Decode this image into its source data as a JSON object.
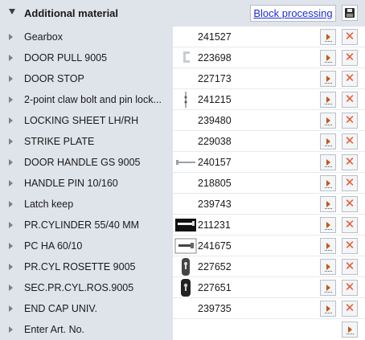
{
  "header": {
    "title": "Additional material",
    "block_processing_label": "Block processing"
  },
  "colors": {
    "panel_bg": "#dfe3ea",
    "link_blue": "#1a2fd6",
    "delete_orange": "#e8572a",
    "play_orange": "#c4561a"
  },
  "rows": [
    {
      "name": "Gearbox",
      "art_no": "241527",
      "thumb": ""
    },
    {
      "name": "DOOR PULL 9005",
      "art_no": "223698",
      "thumb": "door-pull-thumbnail"
    },
    {
      "name": "DOOR STOP",
      "art_no": "227173",
      "thumb": ""
    },
    {
      "name": "2-point claw bolt and pin lock...",
      "art_no": "241215",
      "thumb": "claw-bolt-thumbnail"
    },
    {
      "name": "LOCKING SHEET LH/RH",
      "art_no": "239480",
      "thumb": ""
    },
    {
      "name": "STRIKE PLATE",
      "art_no": "229038",
      "thumb": ""
    },
    {
      "name": "DOOR HANDLE GS 9005",
      "art_no": "240157",
      "thumb": "door-handle-thumbnail"
    },
    {
      "name": "HANDLE PIN 10/160",
      "art_no": "218805",
      "thumb": ""
    },
    {
      "name": "Latch keep",
      "art_no": "239743",
      "thumb": ""
    },
    {
      "name": "PR.CYLINDER 55/40 MM",
      "art_no": "211231",
      "thumb": "cylinder-thumbnail"
    },
    {
      "name": "PC HA 60/10",
      "art_no": "241675",
      "thumb": "pc-ha-thumbnail"
    },
    {
      "name": "PR.CYL ROSETTE 9005",
      "art_no": "227652",
      "thumb": "rosette-thumbnail"
    },
    {
      "name": "SEC.PR.CYL.ROS.9005",
      "art_no": "227651",
      "thumb": "sec-rosette-thumbnail"
    },
    {
      "name": "END CAP UNIV.",
      "art_no": "239735",
      "thumb": ""
    }
  ],
  "enter_row": {
    "placeholder_label": "Enter Art. No."
  }
}
